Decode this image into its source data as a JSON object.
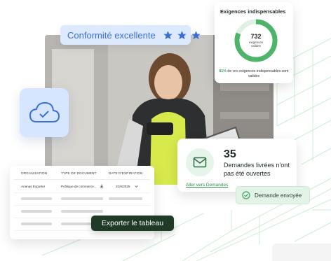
{
  "compliance": {
    "label": "Conformité excellente",
    "stars": 3
  },
  "cloud_icon": "cloud-check-icon",
  "requirements": {
    "title": "Exigences indispensables",
    "count": "732",
    "count_label": "exigences valides",
    "percent": "81%",
    "description": "de vos exigences indispensables sont valides",
    "ratio": 0.81,
    "ring_color": "#4cb56a",
    "track_color": "#dff1e4"
  },
  "requests": {
    "count": "35",
    "text": "Demandes livrées n'ont pas été ouvertes",
    "link": "Aller vers Demandes",
    "icon": "mail-icon"
  },
  "sent_badge": {
    "label": "Demande envoyée",
    "icon": "check-circle-icon"
  },
  "table": {
    "headers": [
      "ORGANISATION",
      "TYPE DE DOCUMENT",
      "DATE D'EXPIRATION"
    ],
    "first_row": {
      "organisation": "Ananas Exporter",
      "document_type": "Politique de commerce...",
      "expiration": "31/8/2025"
    }
  },
  "export_button": "Exporter le tableau",
  "colors": {
    "brand_dark": "#1f3b27",
    "accent_green": "#4cb56a",
    "blue": "#3a6fd8"
  }
}
